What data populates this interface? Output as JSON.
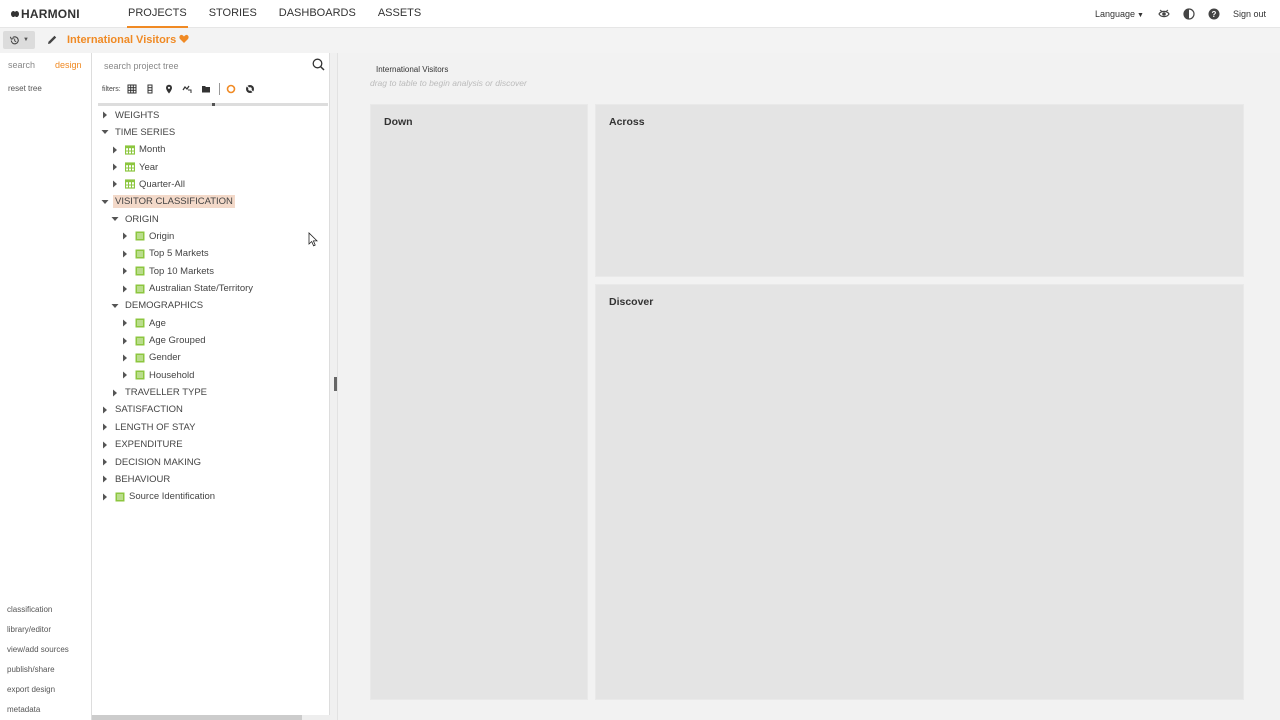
{
  "app": {
    "logo_text": "HARMONI"
  },
  "nav": {
    "tabs": [
      {
        "label": "PROJECTS",
        "active": true
      },
      {
        "label": "STORIES",
        "active": false
      },
      {
        "label": "DASHBOARDS",
        "active": false
      },
      {
        "label": "ASSETS",
        "active": false
      }
    ],
    "language_label": "Language",
    "sign_out_label": "Sign out",
    "icons": [
      "eye-icon",
      "contrast-icon",
      "help-icon"
    ]
  },
  "project": {
    "title": "International Visitors",
    "favorite": true
  },
  "left": {
    "tabs": {
      "search": "search",
      "design": "design"
    },
    "reset_tree": "reset tree",
    "links": [
      "classification",
      "library/editor",
      "view/add sources",
      "publish/share",
      "export design",
      "metadata"
    ]
  },
  "tree_panel": {
    "search_placeholder": "search project tree",
    "filters_label": "filters:",
    "nodes": [
      {
        "label": "WEIGHTS",
        "state": "collapsed",
        "icon": "none"
      },
      {
        "label": "TIME SERIES",
        "state": "expanded",
        "icon": "none"
      },
      {
        "label": "Month",
        "state": "collapsed",
        "icon": "time-variable-icon"
      },
      {
        "label": "Year",
        "state": "collapsed",
        "icon": "time-variable-icon"
      },
      {
        "label": "Quarter-All",
        "state": "collapsed",
        "icon": "time-variable-icon"
      },
      {
        "label": "VISITOR CLASSIFICATION",
        "state": "expanded",
        "icon": "none",
        "highlighted": true
      },
      {
        "label": "ORIGIN",
        "state": "expanded",
        "icon": "none"
      },
      {
        "label": "Origin",
        "state": "collapsed",
        "icon": "classification-icon"
      },
      {
        "label": "Top 5 Markets",
        "state": "collapsed",
        "icon": "classification-icon"
      },
      {
        "label": "Top 10 Markets",
        "state": "collapsed",
        "icon": "classification-icon"
      },
      {
        "label": "Australian State/Territory",
        "state": "collapsed",
        "icon": "classification-icon"
      },
      {
        "label": "DEMOGRAPHICS",
        "state": "expanded",
        "icon": "none"
      },
      {
        "label": "Age",
        "state": "collapsed",
        "icon": "classification-icon"
      },
      {
        "label": "Age Grouped",
        "state": "collapsed",
        "icon": "classification-icon"
      },
      {
        "label": "Gender",
        "state": "collapsed",
        "icon": "classification-icon"
      },
      {
        "label": "Household",
        "state": "collapsed",
        "icon": "classification-icon"
      },
      {
        "label": "TRAVELLER TYPE",
        "state": "collapsed",
        "icon": "none"
      },
      {
        "label": "SATISFACTION",
        "state": "collapsed",
        "icon": "none"
      },
      {
        "label": "LENGTH OF STAY",
        "state": "collapsed",
        "icon": "none"
      },
      {
        "label": "EXPENDITURE",
        "state": "collapsed",
        "icon": "none"
      },
      {
        "label": "DECISION MAKING",
        "state": "collapsed",
        "icon": "none"
      },
      {
        "label": "BEHAVIOUR",
        "state": "collapsed",
        "icon": "none"
      },
      {
        "label": "Source Identification",
        "state": "collapsed",
        "icon": "classification-icon"
      }
    ]
  },
  "main": {
    "title": "International Visitors",
    "hint": "drag to table to begin analysis or discover",
    "panels": {
      "down": "Down",
      "across": "Across",
      "discover": "Discover"
    }
  },
  "colors": {
    "accent": "#f08a24",
    "classification": "#8cc63f",
    "highlight": "#f3d9c9"
  }
}
